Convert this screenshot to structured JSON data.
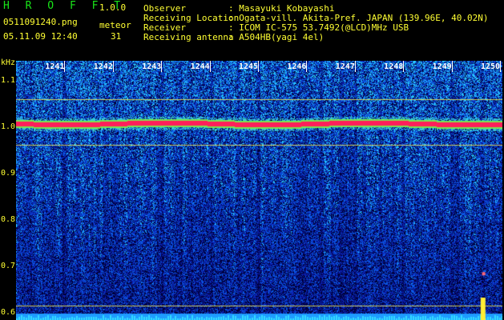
{
  "app": {
    "name": "H R O F F T",
    "version": "1.0.0"
  },
  "file": {
    "name": "0511091240.png",
    "datetime": "05.11.09 12:40"
  },
  "mode": {
    "label": "meteor",
    "count": "31"
  },
  "station": {
    "rows": [
      {
        "key": "Observer",
        "value": ": Masayuki Kobayashi"
      },
      {
        "key": "Receiving Location",
        "value": ": Ogata-vill. Akita-Pref. JAPAN (139.96E, 40.02N)"
      },
      {
        "key": "Receiver",
        "value": ": ICOM IC-575 53.7492(@LCD)MHz USB"
      },
      {
        "key": "Receiving antenna",
        "value": ": A504HB(yagi 4el)"
      }
    ]
  },
  "axis": {
    "unit": "kHz",
    "y_labels": [
      "1.1",
      "1.0",
      "0.9",
      "0.8",
      "0.7",
      "0.6"
    ],
    "y_values": [
      1.1,
      1.0,
      0.9,
      0.8,
      0.7,
      0.6
    ],
    "ylim": [
      0.587,
      1.145
    ],
    "time_labels": [
      "1241",
      "1242",
      "1243",
      "1244",
      "1245",
      "1246",
      "1247",
      "1248",
      "1249",
      "1250"
    ],
    "time_values": [
      1241,
      1242,
      1243,
      1244,
      1245,
      1246,
      1247,
      1248,
      1249,
      1250
    ],
    "time_range": [
      1240,
      1250.05
    ]
  },
  "signal": {
    "carrier_khz": 1.01,
    "guide_lines_khz": [
      1.063,
      0.965,
      0.618
    ]
  },
  "colors": {
    "header_text": "#ffff33",
    "brand": "#19e619",
    "background_dark": "#000010",
    "noise_blue": "#1030c0",
    "carrier": "#ff2060",
    "guide": "#d0d060"
  }
}
